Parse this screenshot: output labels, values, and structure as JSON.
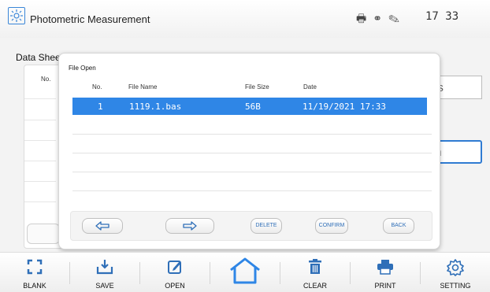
{
  "header": {
    "app_title": "Photometric Measurement",
    "time": "17 33",
    "status_icons": [
      "printer-icon",
      "camera-icon",
      "pen-icon"
    ]
  },
  "background": {
    "title": "Data Sheet",
    "table_col": "No.",
    "box1_text": "bs",
    "box2_text": "m"
  },
  "dialog": {
    "title": "File Open",
    "columns": [
      "No.",
      "File Name",
      "File Size",
      "Date"
    ],
    "rows": [
      {
        "no": "1",
        "name": "1119.1.bas",
        "size": "56B",
        "date": "11/19/2021 17:33",
        "selected": true
      }
    ],
    "buttons": {
      "prev": "prev-arrow",
      "next": "next-arrow",
      "delete": "DELETE",
      "confirm": "CONFIRM",
      "back": "BACK"
    }
  },
  "toolbar": {
    "items": [
      {
        "label": "BLANK",
        "icon": "blank-icon"
      },
      {
        "label": "SAVE",
        "icon": "save-icon"
      },
      {
        "label": "OPEN",
        "icon": "open-icon"
      },
      {
        "label": "",
        "icon": "home-icon"
      },
      {
        "label": "CLEAR",
        "icon": "trash-icon"
      },
      {
        "label": "PRINT",
        "icon": "printer-icon"
      },
      {
        "label": "SETTING",
        "icon": "gear-icon"
      }
    ]
  },
  "colors": {
    "accent": "#2f86e6",
    "selection_text": "#ffffff",
    "button_text": "#2f6fb8"
  }
}
